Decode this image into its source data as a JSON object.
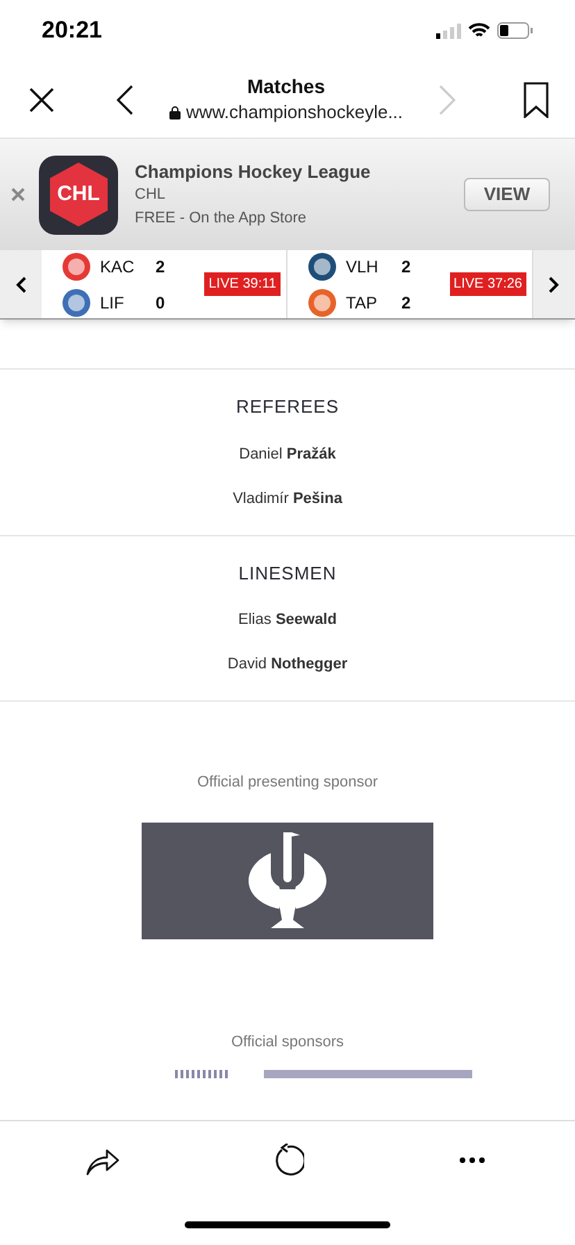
{
  "status_bar": {
    "time": "20:21"
  },
  "browser": {
    "title": "Matches",
    "url": "www.championshockeyle..."
  },
  "app_banner": {
    "name": "Champions Hockey League",
    "developer": "CHL",
    "price": "FREE - On the App Store",
    "button": "VIEW",
    "logo_text": "CHL"
  },
  "ticker": [
    {
      "teams": [
        {
          "abbr": "KAC",
          "score": "2"
        },
        {
          "abbr": "LIF",
          "score": "0"
        }
      ],
      "status": "LIVE 39:11"
    },
    {
      "teams": [
        {
          "abbr": "VLH",
          "score": "2"
        },
        {
          "abbr": "TAP",
          "score": "2"
        }
      ],
      "status": "LIVE 37:26"
    }
  ],
  "sections": [
    {
      "title": "REFEREES",
      "names": [
        "Daniel **Pražák**",
        "Vladimír **Pešina**"
      ]
    },
    {
      "title": "LINESMEN",
      "names": [
        "Elias **Seewald**",
        "David **Nothegger**"
      ]
    }
  ],
  "presenting_sponsor": {
    "label": "Official presenting sponsor"
  },
  "sponsors": {
    "label": "Official sponsors"
  }
}
